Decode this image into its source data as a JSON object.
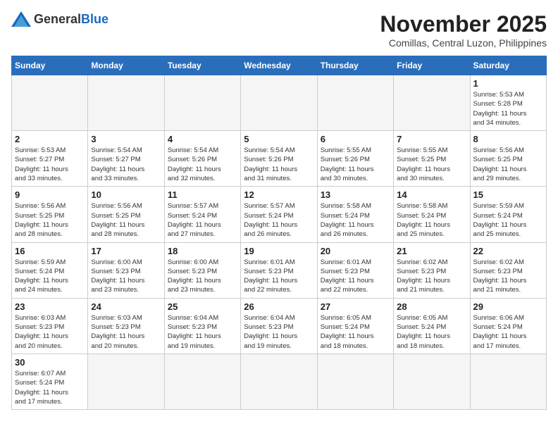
{
  "header": {
    "logo": {
      "general": "General",
      "blue": "Blue"
    },
    "title": "November 2025",
    "subtitle": "Comillas, Central Luzon, Philippines"
  },
  "weekdays": [
    "Sunday",
    "Monday",
    "Tuesday",
    "Wednesday",
    "Thursday",
    "Friday",
    "Saturday"
  ],
  "weeks": [
    [
      {
        "day": null,
        "info": null
      },
      {
        "day": null,
        "info": null
      },
      {
        "day": null,
        "info": null
      },
      {
        "day": null,
        "info": null
      },
      {
        "day": null,
        "info": null
      },
      {
        "day": null,
        "info": null
      },
      {
        "day": "1",
        "info": "Sunrise: 5:53 AM\nSunset: 5:28 PM\nDaylight: 11 hours\nand 34 minutes."
      }
    ],
    [
      {
        "day": "2",
        "info": "Sunrise: 5:53 AM\nSunset: 5:27 PM\nDaylight: 11 hours\nand 33 minutes."
      },
      {
        "day": "3",
        "info": "Sunrise: 5:54 AM\nSunset: 5:27 PM\nDaylight: 11 hours\nand 33 minutes."
      },
      {
        "day": "4",
        "info": "Sunrise: 5:54 AM\nSunset: 5:26 PM\nDaylight: 11 hours\nand 32 minutes."
      },
      {
        "day": "5",
        "info": "Sunrise: 5:54 AM\nSunset: 5:26 PM\nDaylight: 11 hours\nand 31 minutes."
      },
      {
        "day": "6",
        "info": "Sunrise: 5:55 AM\nSunset: 5:26 PM\nDaylight: 11 hours\nand 30 minutes."
      },
      {
        "day": "7",
        "info": "Sunrise: 5:55 AM\nSunset: 5:25 PM\nDaylight: 11 hours\nand 30 minutes."
      },
      {
        "day": "8",
        "info": "Sunrise: 5:56 AM\nSunset: 5:25 PM\nDaylight: 11 hours\nand 29 minutes."
      }
    ],
    [
      {
        "day": "9",
        "info": "Sunrise: 5:56 AM\nSunset: 5:25 PM\nDaylight: 11 hours\nand 28 minutes."
      },
      {
        "day": "10",
        "info": "Sunrise: 5:56 AM\nSunset: 5:25 PM\nDaylight: 11 hours\nand 28 minutes."
      },
      {
        "day": "11",
        "info": "Sunrise: 5:57 AM\nSunset: 5:24 PM\nDaylight: 11 hours\nand 27 minutes."
      },
      {
        "day": "12",
        "info": "Sunrise: 5:57 AM\nSunset: 5:24 PM\nDaylight: 11 hours\nand 26 minutes."
      },
      {
        "day": "13",
        "info": "Sunrise: 5:58 AM\nSunset: 5:24 PM\nDaylight: 11 hours\nand 26 minutes."
      },
      {
        "day": "14",
        "info": "Sunrise: 5:58 AM\nSunset: 5:24 PM\nDaylight: 11 hours\nand 25 minutes."
      },
      {
        "day": "15",
        "info": "Sunrise: 5:59 AM\nSunset: 5:24 PM\nDaylight: 11 hours\nand 25 minutes."
      }
    ],
    [
      {
        "day": "16",
        "info": "Sunrise: 5:59 AM\nSunset: 5:24 PM\nDaylight: 11 hours\nand 24 minutes."
      },
      {
        "day": "17",
        "info": "Sunrise: 6:00 AM\nSunset: 5:23 PM\nDaylight: 11 hours\nand 23 minutes."
      },
      {
        "day": "18",
        "info": "Sunrise: 6:00 AM\nSunset: 5:23 PM\nDaylight: 11 hours\nand 23 minutes."
      },
      {
        "day": "19",
        "info": "Sunrise: 6:01 AM\nSunset: 5:23 PM\nDaylight: 11 hours\nand 22 minutes."
      },
      {
        "day": "20",
        "info": "Sunrise: 6:01 AM\nSunset: 5:23 PM\nDaylight: 11 hours\nand 22 minutes."
      },
      {
        "day": "21",
        "info": "Sunrise: 6:02 AM\nSunset: 5:23 PM\nDaylight: 11 hours\nand 21 minutes."
      },
      {
        "day": "22",
        "info": "Sunrise: 6:02 AM\nSunset: 5:23 PM\nDaylight: 11 hours\nand 21 minutes."
      }
    ],
    [
      {
        "day": "23",
        "info": "Sunrise: 6:03 AM\nSunset: 5:23 PM\nDaylight: 11 hours\nand 20 minutes."
      },
      {
        "day": "24",
        "info": "Sunrise: 6:03 AM\nSunset: 5:23 PM\nDaylight: 11 hours\nand 20 minutes."
      },
      {
        "day": "25",
        "info": "Sunrise: 6:04 AM\nSunset: 5:23 PM\nDaylight: 11 hours\nand 19 minutes."
      },
      {
        "day": "26",
        "info": "Sunrise: 6:04 AM\nSunset: 5:23 PM\nDaylight: 11 hours\nand 19 minutes."
      },
      {
        "day": "27",
        "info": "Sunrise: 6:05 AM\nSunset: 5:24 PM\nDaylight: 11 hours\nand 18 minutes."
      },
      {
        "day": "28",
        "info": "Sunrise: 6:05 AM\nSunset: 5:24 PM\nDaylight: 11 hours\nand 18 minutes."
      },
      {
        "day": "29",
        "info": "Sunrise: 6:06 AM\nSunset: 5:24 PM\nDaylight: 11 hours\nand 17 minutes."
      }
    ],
    [
      {
        "day": "30",
        "info": "Sunrise: 6:07 AM\nSunset: 5:24 PM\nDaylight: 11 hours\nand 17 minutes."
      },
      {
        "day": null,
        "info": null
      },
      {
        "day": null,
        "info": null
      },
      {
        "day": null,
        "info": null
      },
      {
        "day": null,
        "info": null
      },
      {
        "day": null,
        "info": null
      },
      {
        "day": null,
        "info": null
      }
    ]
  ]
}
